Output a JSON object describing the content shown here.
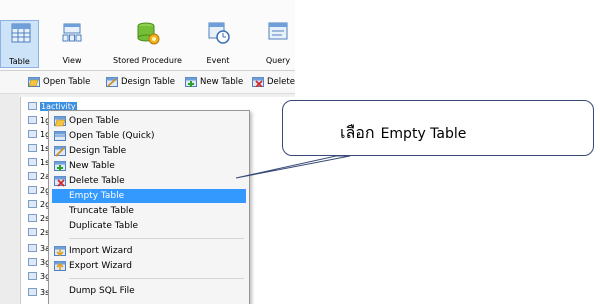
{
  "ribbon": {
    "items": [
      {
        "label": "Table",
        "icon": "table-icon"
      },
      {
        "label": "View",
        "icon": "view-icon"
      },
      {
        "label": "Stored Procedure",
        "icon": "stored-procedure-icon"
      },
      {
        "label": "Event",
        "icon": "event-icon"
      },
      {
        "label": "Query",
        "icon": "query-icon"
      }
    ]
  },
  "toolbar": {
    "open_table": "Open Table",
    "design_table": "Design Table",
    "new_table": "New Table",
    "delete": "Delete"
  },
  "tree": {
    "rows": [
      "1activity",
      "1gra",
      "1gro",
      "1stu",
      "1sub",
      "2act",
      "2gra",
      "2gro",
      "2stu",
      "2sub",
      "3act",
      "3gra",
      "3gro",
      "3stu"
    ]
  },
  "context_menu": {
    "items": [
      {
        "label": "Open Table",
        "icon": "open-table-icon"
      },
      {
        "label": "Open Table (Quick)",
        "icon": "open-table-quick-icon"
      },
      {
        "label": "Design Table",
        "icon": "design-table-icon"
      },
      {
        "label": "New Table",
        "icon": "new-table-icon"
      },
      {
        "label": "Delete Table",
        "icon": "delete-table-icon"
      },
      {
        "label": "Empty Table",
        "icon": ""
      },
      {
        "label": "Truncate Table",
        "icon": ""
      },
      {
        "label": "Duplicate Table",
        "icon": ""
      },
      {
        "label": "Import Wizard",
        "icon": "import-wizard-icon"
      },
      {
        "label": "Export Wizard",
        "icon": "export-wizard-icon"
      },
      {
        "label": "Dump SQL File",
        "icon": ""
      }
    ]
  },
  "callout": {
    "thai": "เลือก",
    "english": "Empty Table"
  },
  "colors": {
    "highlight": "#3399ff",
    "selected_row": "#3d8fe0",
    "callout_border": "#3a4a78"
  }
}
